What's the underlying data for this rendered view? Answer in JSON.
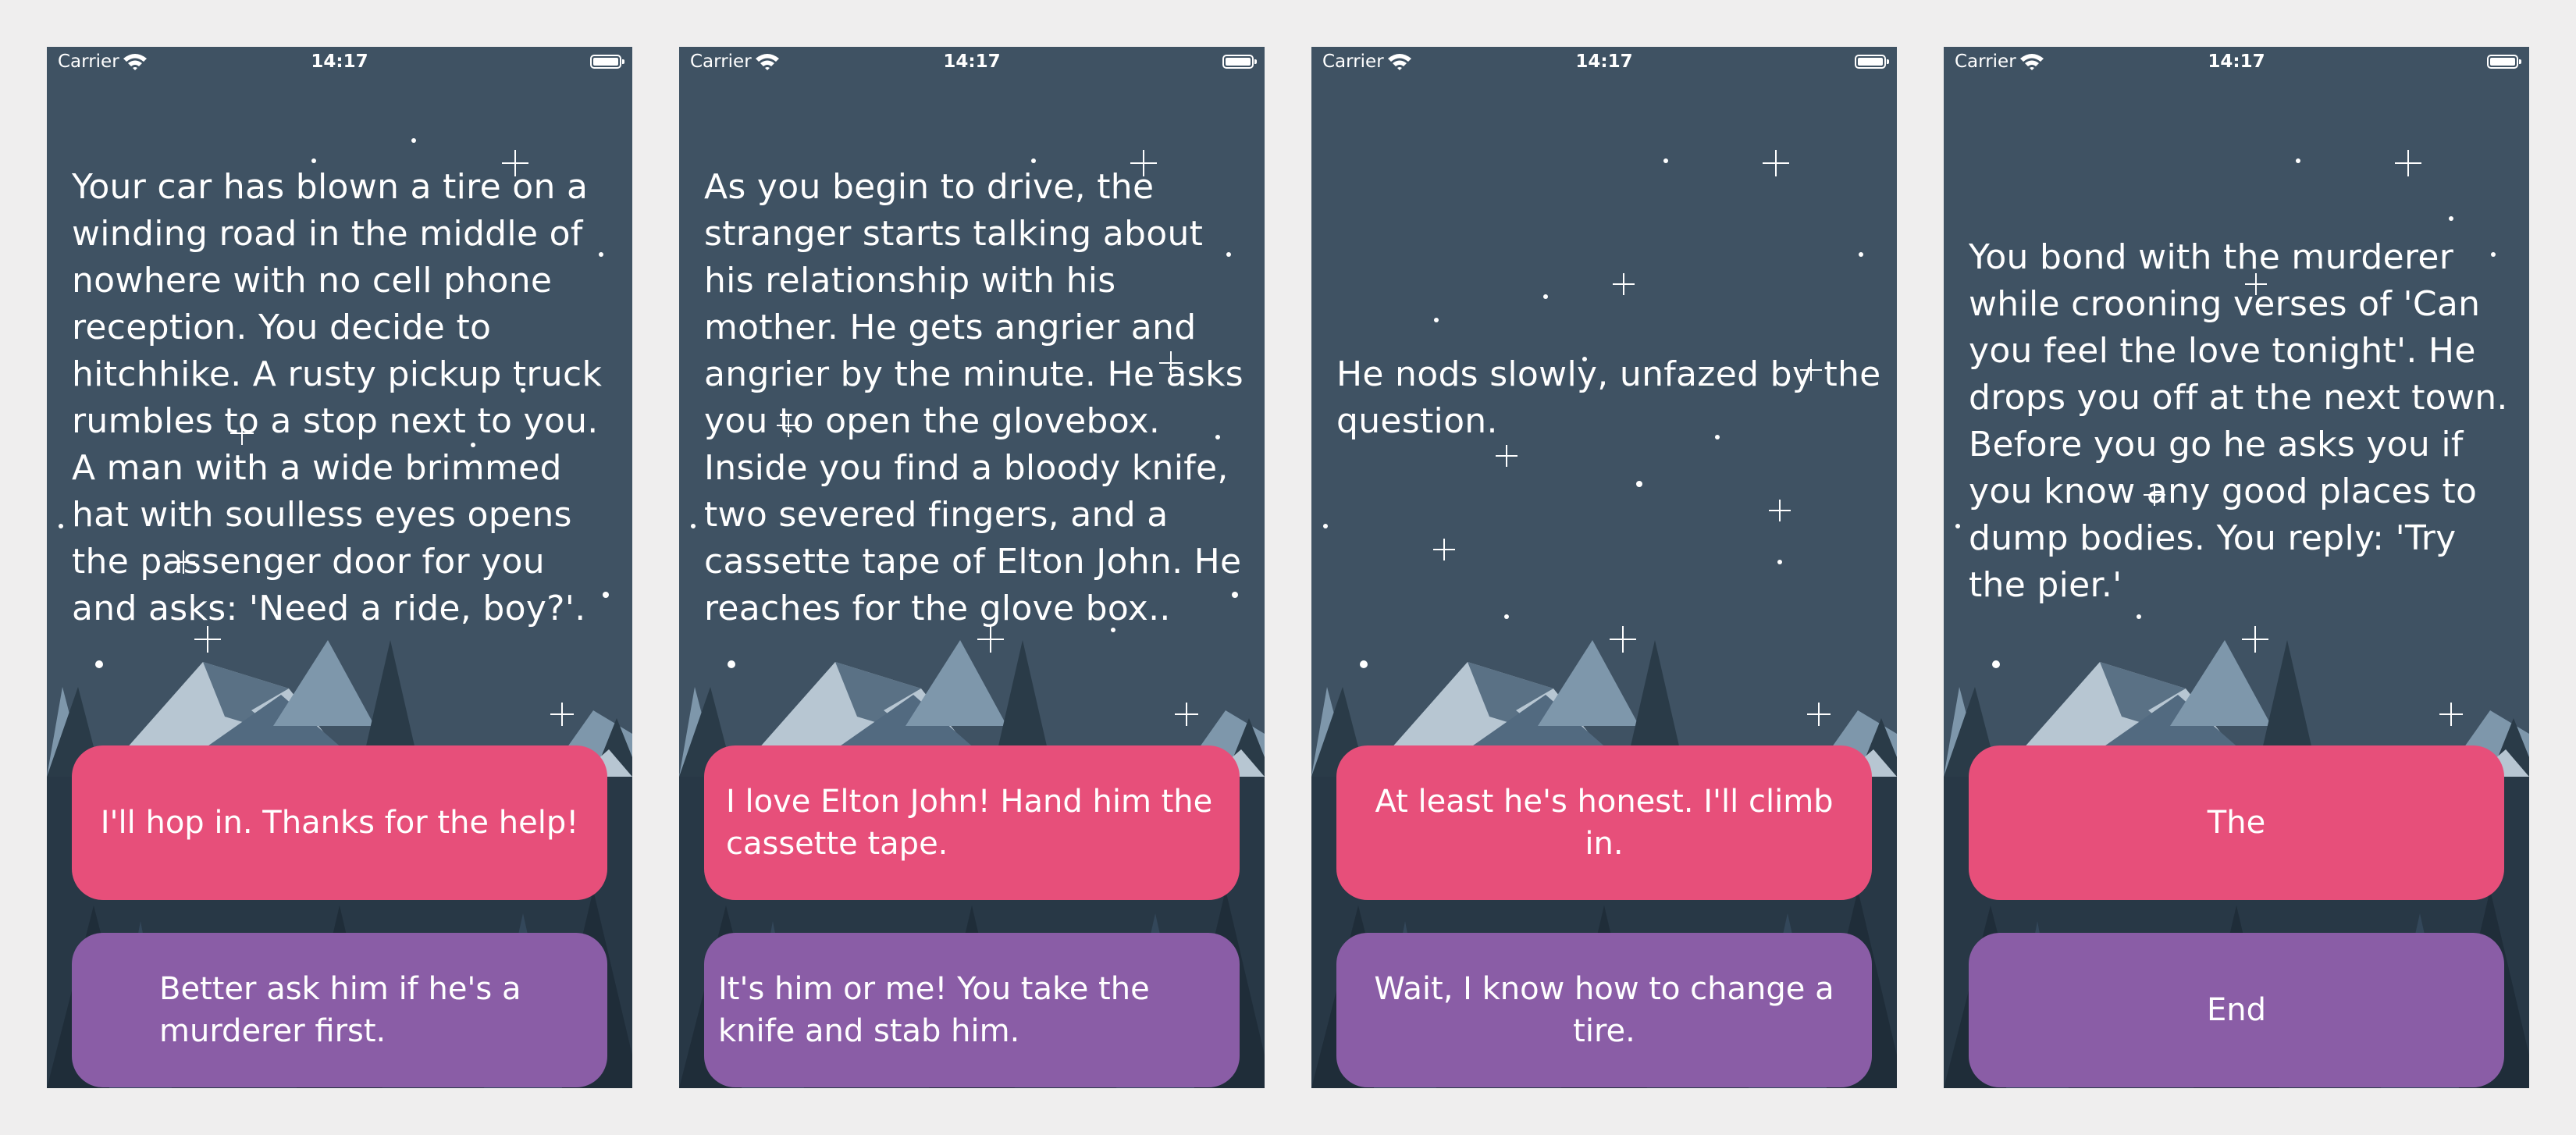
{
  "status": {
    "carrier": "Carrier",
    "time": "14:17"
  },
  "colors": {
    "background": "#3f5263",
    "choice_primary": "#e74f7a",
    "choice_secondary": "#8a5da6",
    "text": "#ffffff"
  },
  "icons": [
    "wifi-icon",
    "battery-icon",
    "sparkle-star-icon",
    "mountain-icon",
    "pine-tree-icon"
  ],
  "screens": [
    {
      "story": "Your car has blown a tire on a winding road in the middle of nowhere with no cell phone reception. You decide to hitchhike. A rusty pickup truck rumbles to a stop next to you. A man with a wide brimmed hat with soulless eyes opens the passenger door for you and asks: 'Need a ride, boy?'.",
      "choice_1": "I'll hop in. Thanks for the help!",
      "choice_2": "Better ask him if he's a murderer first."
    },
    {
      "story": "As you begin to drive, the stranger starts talking about his relationship with his mother. He gets angrier and angrier by the minute. He asks you to open the glovebox. Inside you find a bloody knife, two severed fingers, and a cassette tape of Elton John. He reaches for the glove box..",
      "choice_1": "I love Elton John! Hand him the cassette tape.",
      "choice_2": "It's him or me! You take the knife and stab him."
    },
    {
      "story": "He nods slowly, unfazed by the question.",
      "choice_1": "At least he's honest. I'll climb in.",
      "choice_2": "Wait, I know how to change a tire."
    },
    {
      "story": "You bond with the murderer while crooning verses of 'Can you feel the love tonight'. He drops you off at the next town. Before you go he asks you if you know any good places to dump bodies. You reply: 'Try the pier.'",
      "choice_1": "The",
      "choice_2": "End"
    }
  ]
}
